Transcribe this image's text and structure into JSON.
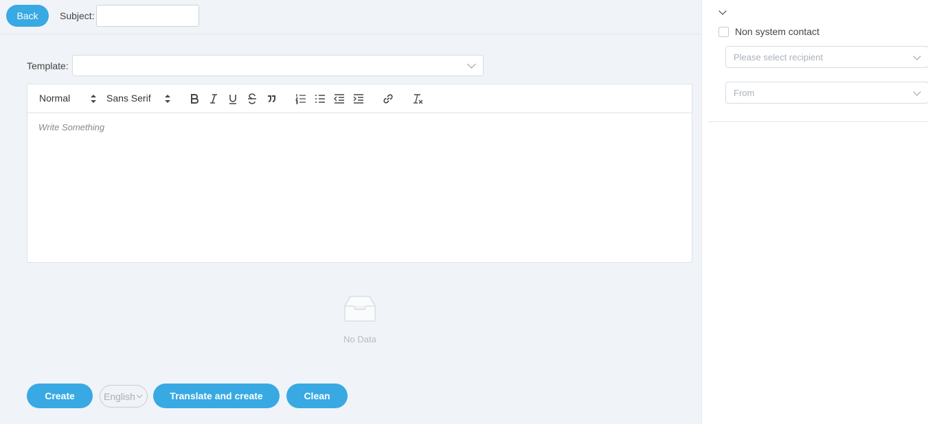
{
  "topbar": {
    "back_label": "Back",
    "subject_label": "Subject:",
    "subject_value": ""
  },
  "template": {
    "label": "Template:",
    "value": ""
  },
  "editor": {
    "size_picker": "Normal",
    "font_picker": "Sans Serif",
    "placeholder": "Write Something",
    "tools": [
      "bold-icon",
      "italic-icon",
      "underline-icon",
      "strikethrough-icon",
      "quote-icon",
      "ordered-list-icon",
      "bullet-list-icon",
      "outdent-icon",
      "indent-icon",
      "link-icon",
      "clear-format-icon"
    ]
  },
  "empty_state": {
    "text": "No Data"
  },
  "actions": {
    "create_label": "Create",
    "language_value": "English",
    "translate_label": "Translate and create",
    "clean_label": "Clean"
  },
  "sidebar": {
    "non_system_contact_label": "Non system contact",
    "recipient_placeholder": "Please select recipient",
    "from_placeholder": "From"
  },
  "colors": {
    "accent": "#38a9e2",
    "background": "#f0f3f7"
  }
}
